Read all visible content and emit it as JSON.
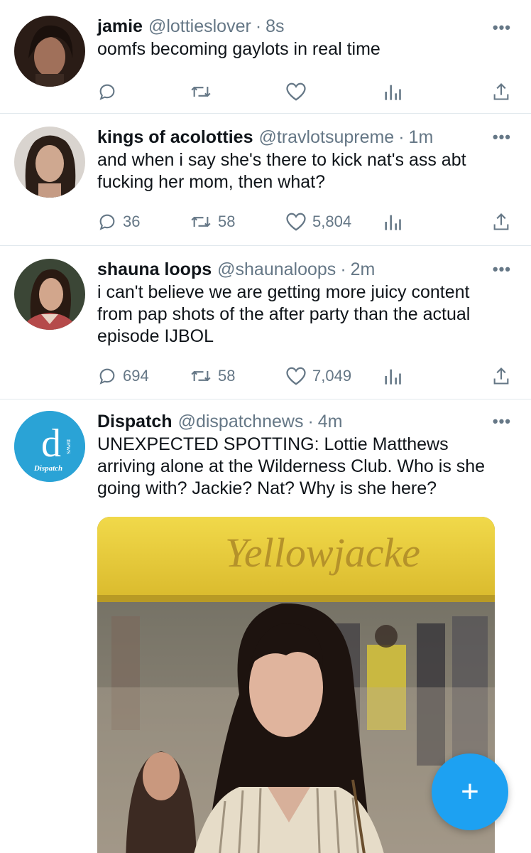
{
  "tweets": [
    {
      "name": "jamie",
      "handle": "@lottieslover",
      "time": "8s",
      "text": "oomfs becoming gaylots in real time",
      "replies": "",
      "retweets": "",
      "likes": ""
    },
    {
      "name": "kings of acolotties",
      "handle": "@travlotsupreme",
      "time": "1m",
      "text": "and when i say she's there to kick nat's ass abt fucking her mom, then what?",
      "replies": "36",
      "retweets": "58",
      "likes": "5,804"
    },
    {
      "name": "shauna loops",
      "handle": "@shaunaloops",
      "time": "2m",
      "text": "i can't believe we are getting more juicy content from pap shots of the after party than the actual episode IJBOL",
      "replies": "694",
      "retweets": "58",
      "likes": "7,049"
    },
    {
      "name": "Dispatch",
      "handle": "@dispatchnews",
      "time": "4m",
      "text": "UNEXPECTED SPOTTING: Lottie Matthews arriving alone at the Wilderness Club. Who is she going with? Jackie? Nat? Why is she here?",
      "avatar_letter": "d",
      "avatar_small": "news",
      "avatar_brand": "Dispatch",
      "media_sign": "Yellowjacke"
    }
  ],
  "dot": "·",
  "more_glyph": "•••",
  "fab_glyph": "+",
  "colors": {
    "accent": "#1da1f2",
    "muted": "#657786",
    "divider": "#e1e8ed"
  }
}
